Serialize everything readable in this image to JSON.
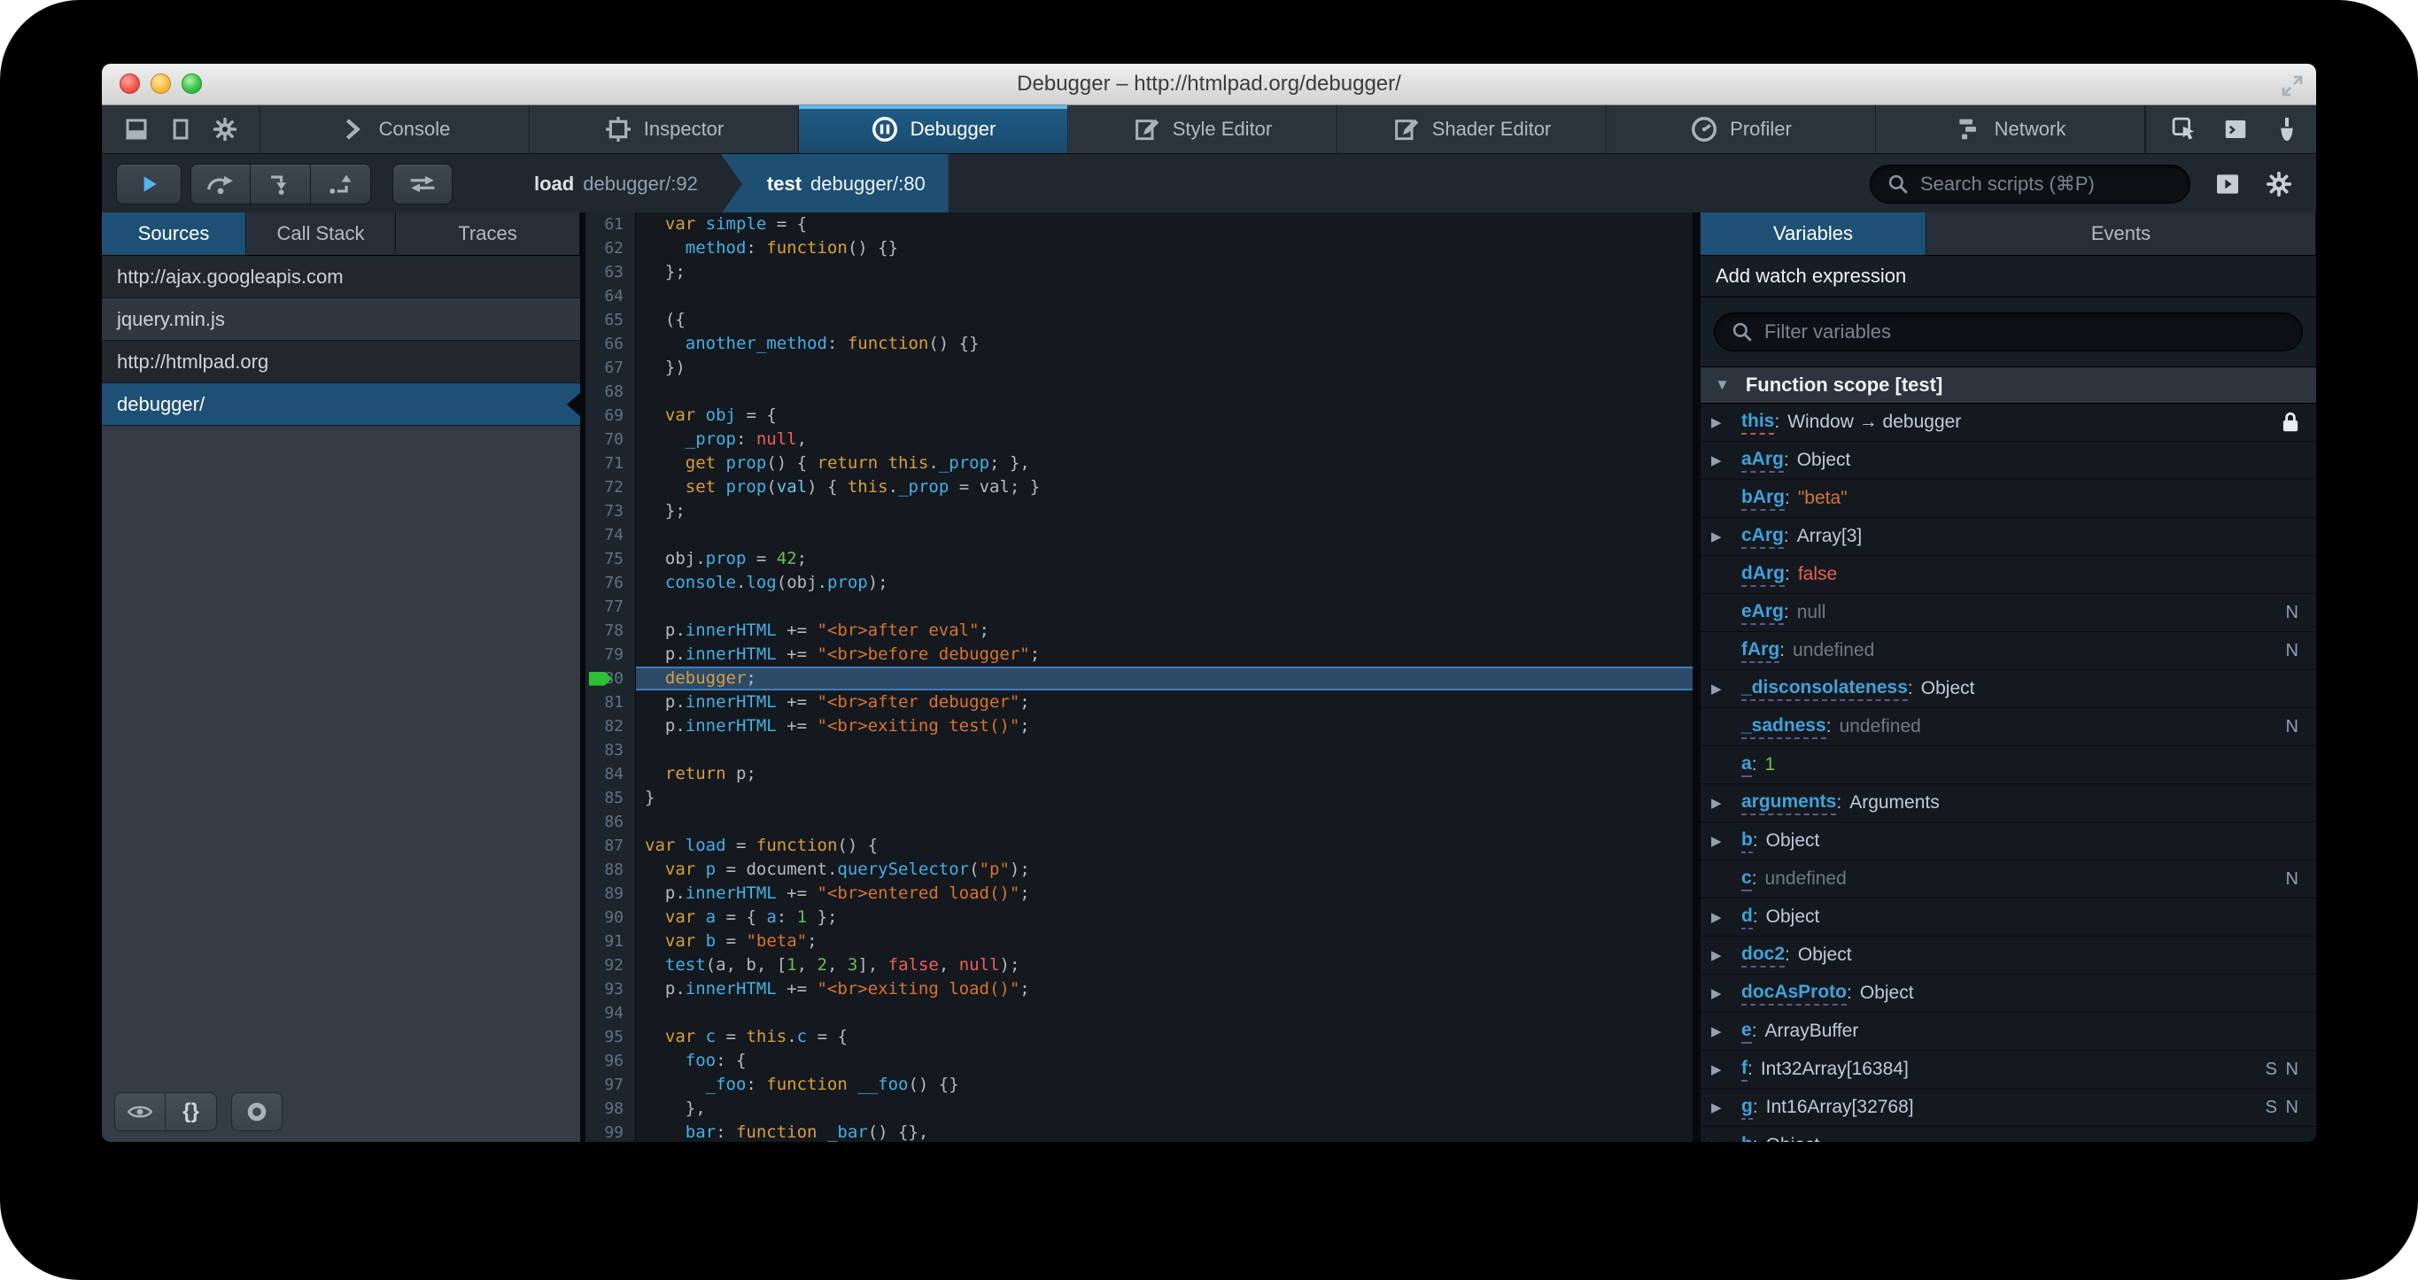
{
  "window": {
    "title": "Debugger – http://htmlpad.org/debugger/"
  },
  "colors": {
    "accent_blue": "#1d4f73",
    "active_tab_stripe": "#5dbbee",
    "current_line_bg": "#2c4a68",
    "keyword_orange": "#d99e3c",
    "identifier_blue": "#46afe3",
    "string_orange": "#d9742e",
    "number_green": "#6fbf4f",
    "atom_red": "#ed5f56",
    "run_arrow_green": "#2cc135"
  },
  "toolbox": {
    "dock_icons": [
      {
        "name": "dock-bottom-icon",
        "icon": "dock-bottom"
      },
      {
        "name": "dock-side-icon",
        "icon": "dock-side"
      },
      {
        "name": "toolbox-options-icon",
        "icon": "gear"
      }
    ],
    "tabs": [
      {
        "label": "Console",
        "icon": "console",
        "active": false
      },
      {
        "label": "Inspector",
        "icon": "inspector",
        "active": false
      },
      {
        "label": "Debugger",
        "icon": "debugger",
        "active": true
      },
      {
        "label": "Style Editor",
        "icon": "edit",
        "active": false
      },
      {
        "label": "Shader Editor",
        "icon": "edit",
        "active": false
      },
      {
        "label": "Profiler",
        "icon": "profiler",
        "active": false
      },
      {
        "label": "Network",
        "icon": "network",
        "active": false
      }
    ],
    "right_icons": [
      "pick-element-icon",
      "split-console-icon",
      "paintbrush-icon",
      "tilt-3d-icon",
      "scratchpad-icon",
      "responsive-design-icon"
    ]
  },
  "debugger_toolbar": {
    "resume_button": "resume",
    "step_buttons": [
      "step-over",
      "step-in",
      "step-out"
    ],
    "blackbox_button": "blackbox",
    "breadcrumbs": [
      {
        "fn": "load",
        "loc": "debugger/:92",
        "active": false
      },
      {
        "fn": "test",
        "loc": "debugger/:80",
        "active": true
      }
    ],
    "search": {
      "placeholder": "Search scripts (⌘P)"
    }
  },
  "sources_panel": {
    "tabs": [
      {
        "label": "Sources",
        "active": true
      },
      {
        "label": "Call Stack",
        "active": false
      },
      {
        "label": "Traces",
        "active": false
      }
    ],
    "items": [
      {
        "label": "http://ajax.googleapis.com",
        "kind": "domain",
        "selected": false
      },
      {
        "label": "jquery.min.js",
        "kind": "file",
        "selected": false
      },
      {
        "label": "http://htmlpad.org",
        "kind": "domain",
        "selected": false
      },
      {
        "label": "debugger/",
        "kind": "file",
        "selected": true
      }
    ],
    "footer_icons": [
      "eye-icon",
      "pretty-print-icon",
      "blackbox-circle-icon"
    ],
    "pretty_print_glyph": "{}"
  },
  "editor": {
    "first_line": 61,
    "current_line": 80,
    "lines": [
      {
        "n": 61,
        "t": [
          [
            "w",
            "  "
          ],
          [
            "k",
            "var"
          ],
          [
            "w",
            " "
          ],
          [
            "b",
            "simple"
          ],
          [
            "w",
            " = {"
          ]
        ]
      },
      {
        "n": 62,
        "t": [
          [
            "w",
            "    "
          ],
          [
            "b",
            "method"
          ],
          [
            "w",
            ": "
          ],
          [
            "k",
            "function"
          ],
          [
            "w",
            "() {}"
          ]
        ]
      },
      {
        "n": 63,
        "t": [
          [
            "w",
            "  };"
          ]
        ]
      },
      {
        "n": 64,
        "t": []
      },
      {
        "n": 65,
        "t": [
          [
            "w",
            "  ({"
          ]
        ]
      },
      {
        "n": 66,
        "t": [
          [
            "w",
            "    "
          ],
          [
            "b",
            "another_method"
          ],
          [
            "w",
            ": "
          ],
          [
            "k",
            "function"
          ],
          [
            "w",
            "() {}"
          ]
        ]
      },
      {
        "n": 67,
        "t": [
          [
            "w",
            "  })"
          ]
        ]
      },
      {
        "n": 68,
        "t": []
      },
      {
        "n": 69,
        "t": [
          [
            "w",
            "  "
          ],
          [
            "k",
            "var"
          ],
          [
            "w",
            " "
          ],
          [
            "b",
            "obj"
          ],
          [
            "w",
            " = {"
          ]
        ]
      },
      {
        "n": 70,
        "t": [
          [
            "w",
            "    "
          ],
          [
            "b",
            "_prop"
          ],
          [
            "w",
            ": "
          ],
          [
            "a",
            "null"
          ],
          [
            "w",
            ","
          ]
        ]
      },
      {
        "n": 71,
        "t": [
          [
            "w",
            "    "
          ],
          [
            "k",
            "get"
          ],
          [
            "w",
            " "
          ],
          [
            "b",
            "prop"
          ],
          [
            "w",
            "() { "
          ],
          [
            "k",
            "return"
          ],
          [
            "w",
            " "
          ],
          [
            "k",
            "this"
          ],
          [
            "w",
            "."
          ],
          [
            "b",
            "_prop"
          ],
          [
            "w",
            "; },"
          ]
        ]
      },
      {
        "n": 72,
        "t": [
          [
            "w",
            "    "
          ],
          [
            "k",
            "set"
          ],
          [
            "w",
            " "
          ],
          [
            "b",
            "prop"
          ],
          [
            "w",
            "("
          ],
          [
            "d",
            "val"
          ],
          [
            "w",
            ") { "
          ],
          [
            "k",
            "this"
          ],
          [
            "w",
            "."
          ],
          [
            "b",
            "_prop"
          ],
          [
            "w",
            " = val; }"
          ]
        ]
      },
      {
        "n": 73,
        "t": [
          [
            "w",
            "  };"
          ]
        ]
      },
      {
        "n": 74,
        "t": []
      },
      {
        "n": 75,
        "t": [
          [
            "w",
            "  obj."
          ],
          [
            "b",
            "prop"
          ],
          [
            "w",
            " = "
          ],
          [
            "n",
            "42"
          ],
          [
            "w",
            ";"
          ]
        ]
      },
      {
        "n": 76,
        "t": [
          [
            "w",
            "  "
          ],
          [
            "b",
            "console"
          ],
          [
            "w",
            "."
          ],
          [
            "b",
            "log"
          ],
          [
            "w",
            "(obj."
          ],
          [
            "b",
            "prop"
          ],
          [
            "w",
            ");"
          ]
        ]
      },
      {
        "n": 77,
        "t": []
      },
      {
        "n": 78,
        "t": [
          [
            "w",
            "  p."
          ],
          [
            "b",
            "innerHTML"
          ],
          [
            "w",
            " += "
          ],
          [
            "s",
            "\"<br>after eval\""
          ],
          [
            "w",
            ";"
          ]
        ]
      },
      {
        "n": 79,
        "t": [
          [
            "w",
            "  p."
          ],
          [
            "b",
            "innerHTML"
          ],
          [
            "w",
            " += "
          ],
          [
            "s",
            "\"<br>before debugger\""
          ],
          [
            "w",
            ";"
          ]
        ]
      },
      {
        "n": 80,
        "t": [
          [
            "w",
            "  "
          ],
          [
            "k",
            "debugger"
          ],
          [
            "w",
            ";"
          ]
        ]
      },
      {
        "n": 81,
        "t": [
          [
            "w",
            "  p."
          ],
          [
            "b",
            "innerHTML"
          ],
          [
            "w",
            " += "
          ],
          [
            "s",
            "\"<br>after debugger\""
          ],
          [
            "w",
            ";"
          ]
        ]
      },
      {
        "n": 82,
        "t": [
          [
            "w",
            "  p."
          ],
          [
            "b",
            "innerHTML"
          ],
          [
            "w",
            " += "
          ],
          [
            "s",
            "\"<br>exiting test()\""
          ],
          [
            "w",
            ";"
          ]
        ]
      },
      {
        "n": 83,
        "t": []
      },
      {
        "n": 84,
        "t": [
          [
            "w",
            "  "
          ],
          [
            "k",
            "return"
          ],
          [
            "w",
            " p;"
          ]
        ]
      },
      {
        "n": 85,
        "t": [
          [
            "w",
            "}"
          ]
        ]
      },
      {
        "n": 86,
        "t": []
      },
      {
        "n": 87,
        "t": [
          [
            "k",
            "var"
          ],
          [
            "w",
            " "
          ],
          [
            "b",
            "load"
          ],
          [
            "w",
            " = "
          ],
          [
            "k",
            "function"
          ],
          [
            "w",
            "() {"
          ]
        ]
      },
      {
        "n": 88,
        "t": [
          [
            "w",
            "  "
          ],
          [
            "k",
            "var"
          ],
          [
            "w",
            " "
          ],
          [
            "b",
            "p"
          ],
          [
            "w",
            " = document."
          ],
          [
            "b",
            "querySelector"
          ],
          [
            "w",
            "("
          ],
          [
            "s",
            "\"p\""
          ],
          [
            "w",
            ");"
          ]
        ]
      },
      {
        "n": 89,
        "t": [
          [
            "w",
            "  p."
          ],
          [
            "b",
            "innerHTML"
          ],
          [
            "w",
            " += "
          ],
          [
            "s",
            "\"<br>entered load()\""
          ],
          [
            "w",
            ";"
          ]
        ]
      },
      {
        "n": 90,
        "t": [
          [
            "w",
            "  "
          ],
          [
            "k",
            "var"
          ],
          [
            "w",
            " "
          ],
          [
            "b",
            "a"
          ],
          [
            "w",
            " = { "
          ],
          [
            "b",
            "a"
          ],
          [
            "w",
            ": "
          ],
          [
            "n",
            "1"
          ],
          [
            "w",
            " };"
          ]
        ]
      },
      {
        "n": 91,
        "t": [
          [
            "w",
            "  "
          ],
          [
            "k",
            "var"
          ],
          [
            "w",
            " "
          ],
          [
            "b",
            "b"
          ],
          [
            "w",
            " = "
          ],
          [
            "s",
            "\"beta\""
          ],
          [
            "w",
            ";"
          ]
        ]
      },
      {
        "n": 92,
        "t": [
          [
            "w",
            "  "
          ],
          [
            "b",
            "test"
          ],
          [
            "w",
            "(a, b, ["
          ],
          [
            "n",
            "1"
          ],
          [
            "w",
            ", "
          ],
          [
            "n",
            "2"
          ],
          [
            "w",
            ", "
          ],
          [
            "n",
            "3"
          ],
          [
            "w",
            "], "
          ],
          [
            "a",
            "false"
          ],
          [
            "w",
            ", "
          ],
          [
            "a",
            "null"
          ],
          [
            "w",
            ");"
          ]
        ]
      },
      {
        "n": 93,
        "t": [
          [
            "w",
            "  p."
          ],
          [
            "b",
            "innerHTML"
          ],
          [
            "w",
            " += "
          ],
          [
            "s",
            "\"<br>exiting load()\""
          ],
          [
            "w",
            ";"
          ]
        ]
      },
      {
        "n": 94,
        "t": []
      },
      {
        "n": 95,
        "t": [
          [
            "w",
            "  "
          ],
          [
            "k",
            "var"
          ],
          [
            "w",
            " "
          ],
          [
            "b",
            "c"
          ],
          [
            "w",
            " = "
          ],
          [
            "k",
            "this"
          ],
          [
            "w",
            "."
          ],
          [
            "b",
            "c"
          ],
          [
            "w",
            " = {"
          ]
        ]
      },
      {
        "n": 96,
        "t": [
          [
            "w",
            "    "
          ],
          [
            "b",
            "foo"
          ],
          [
            "w",
            ": {"
          ]
        ]
      },
      {
        "n": 97,
        "t": [
          [
            "w",
            "      "
          ],
          [
            "b",
            "_foo"
          ],
          [
            "w",
            ": "
          ],
          [
            "k",
            "function"
          ],
          [
            "w",
            " "
          ],
          [
            "b",
            "__foo"
          ],
          [
            "w",
            "() {}"
          ]
        ]
      },
      {
        "n": 98,
        "t": [
          [
            "w",
            "    },"
          ]
        ]
      },
      {
        "n": 99,
        "t": [
          [
            "w",
            "    "
          ],
          [
            "b",
            "bar"
          ],
          [
            "w",
            ": "
          ],
          [
            "k",
            "function"
          ],
          [
            "w",
            " "
          ],
          [
            "b",
            "_bar"
          ],
          [
            "w",
            "() {},"
          ]
        ]
      }
    ]
  },
  "variables_panel": {
    "tabs": [
      {
        "label": "Variables",
        "active": true
      },
      {
        "label": "Events",
        "active": false
      }
    ],
    "watch_label": "Add watch expression",
    "filter_placeholder": "Filter variables",
    "scope": {
      "label": "Function scope [test]",
      "expanded": true,
      "expander_glyph": "▼"
    },
    "expander_glyph": "▶",
    "variables": [
      {
        "name": "this",
        "value": "Window → debugger",
        "type": "obj",
        "expandable": true,
        "locked": true,
        "underline": "red",
        "badges": ""
      },
      {
        "name": "aArg",
        "value": "Object",
        "type": "obj",
        "expandable": true,
        "badges": ""
      },
      {
        "name": "bArg",
        "value": "\"beta\"",
        "type": "string",
        "expandable": false,
        "badges": ""
      },
      {
        "name": "cArg",
        "value": "Array[3]",
        "type": "obj",
        "expandable": true,
        "badges": ""
      },
      {
        "name": "dArg",
        "value": "false",
        "type": "bool",
        "expandable": false,
        "badges": ""
      },
      {
        "name": "eArg",
        "value": "null",
        "type": "null",
        "expandable": false,
        "badges": "N"
      },
      {
        "name": "fArg",
        "value": "undefined",
        "type": "undef",
        "expandable": false,
        "badges": "N"
      },
      {
        "name": "_disconsolateness",
        "value": "Object",
        "type": "obj",
        "expandable": true,
        "badges": ""
      },
      {
        "name": "_sadness",
        "value": "undefined",
        "type": "undef",
        "expandable": false,
        "badges": "N"
      },
      {
        "name": "a",
        "value": "1",
        "type": "number",
        "expandable": false,
        "badges": ""
      },
      {
        "name": "arguments",
        "value": "Arguments",
        "type": "obj",
        "expandable": true,
        "badges": ""
      },
      {
        "name": "b",
        "value": "Object",
        "type": "obj",
        "expandable": true,
        "badges": ""
      },
      {
        "name": "c",
        "value": "undefined",
        "type": "undef",
        "expandable": false,
        "badges": "N"
      },
      {
        "name": "d",
        "value": "Object",
        "type": "obj",
        "expandable": true,
        "badges": ""
      },
      {
        "name": "doc2",
        "value": "Object",
        "type": "obj",
        "expandable": true,
        "badges": ""
      },
      {
        "name": "docAsProto",
        "value": "Object",
        "type": "obj",
        "expandable": true,
        "badges": ""
      },
      {
        "name": "e",
        "value": "ArrayBuffer",
        "type": "obj",
        "expandable": true,
        "badges": ""
      },
      {
        "name": "f",
        "value": "Int32Array[16384]",
        "type": "obj",
        "expandable": true,
        "badges": "S N"
      },
      {
        "name": "g",
        "value": "Int16Array[32768]",
        "type": "obj",
        "expandable": true,
        "badges": "S N"
      },
      {
        "name": "h",
        "value": "Object",
        "type": "obj",
        "expandable": true,
        "badges": ""
      }
    ]
  }
}
